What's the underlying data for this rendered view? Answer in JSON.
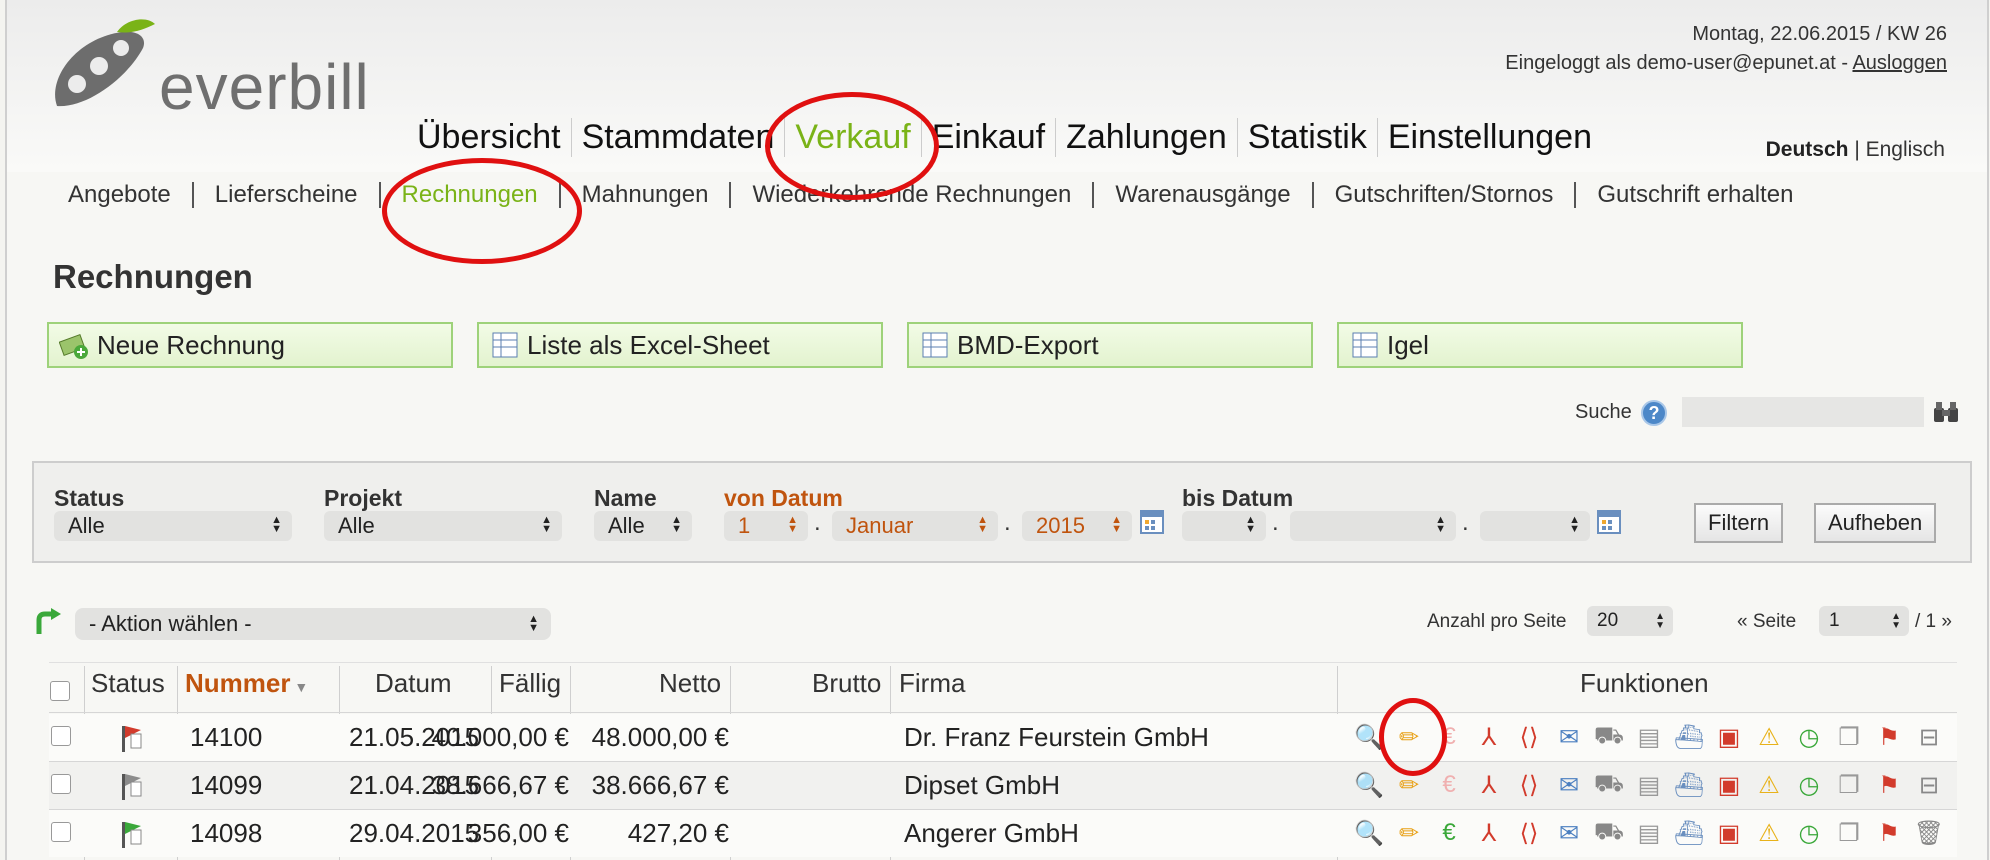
{
  "header": {
    "logo_text": "everbill",
    "date_line": "Montag, 22.06.2015 / KW 26",
    "login_prefix": "Eingeloggt als demo-user@epunet.at - ",
    "logout_label": "Ausloggen"
  },
  "mainnav": [
    "Übersicht",
    "Stammdaten",
    "Verkauf",
    "Einkauf",
    "Zahlungen",
    "Statistik",
    "Einstellungen"
  ],
  "lang": {
    "de": "Deutsch",
    "sep": " | ",
    "en": "Englisch"
  },
  "subnav": [
    "Angebote",
    "Lieferscheine",
    "Rechnungen",
    "Mahnungen",
    "Wiederkehrende Rechnungen",
    "Warenausgänge",
    "Gutschriften/Stornos",
    "Gutschrift erhalten"
  ],
  "page_title": "Rechnungen",
  "actions": [
    "Neue Rechnung",
    "Liste als Excel-Sheet",
    "BMD-Export",
    "Igel"
  ],
  "search": {
    "label": "Suche",
    "help": "?",
    "value": ""
  },
  "filter": {
    "status_label": "Status",
    "status_value": "Alle",
    "projekt_label": "Projekt",
    "projekt_value": "Alle",
    "name_label": "Name",
    "name_value": "Alle",
    "von_label": "von Datum",
    "von_day": "1",
    "von_month": "Januar",
    "von_year": "2015",
    "bis_label": "bis Datum",
    "bis_day": "",
    "bis_month": "",
    "bis_year": "",
    "dot": ".",
    "filter_button": "Filtern",
    "reset_button": "Aufheben"
  },
  "list_controls": {
    "action_select": "- Aktion wählen -",
    "per_page_label": "Anzahl pro Seite",
    "per_page_value": "20",
    "page_prefix": "« Seite",
    "page_value": "1",
    "page_suffix": "/ 1 »"
  },
  "table": {
    "headers": {
      "status": "Status",
      "nummer": "Nummer",
      "datum": "Datum",
      "faellig": "Fällig",
      "netto": "Netto",
      "brutto": "Brutto",
      "firma": "Firma",
      "funktionen": "Funktionen"
    },
    "rows": [
      {
        "nummer": "14100",
        "datum": "21.05.2015",
        "faellig": "",
        "netto": "40.000,00 €",
        "brutto": "48.000,00 €",
        "firma": "Dr. Franz Feurstein GmbH",
        "flag_color": "#d23b2c"
      },
      {
        "nummer": "14099",
        "datum": "21.04.2015",
        "faellig": "",
        "netto": "38.666,67 €",
        "brutto": "38.666,67 €",
        "firma": "Dipset GmbH",
        "flag_color": "#8c8c8c"
      },
      {
        "nummer": "14098",
        "datum": "29.04.2015",
        "faellig": "",
        "netto": "356,00 €",
        "brutto": "427,20 €",
        "firma": "Angerer GmbH",
        "flag_color": "#3aa83a"
      }
    ],
    "function_icons": [
      "magnifier-icon",
      "pencil-icon",
      "euro-icon",
      "pdf-icon",
      "xml-icon",
      "mail-icon",
      "cart-icon",
      "document-icon",
      "ship-icon",
      "reminder-icon",
      "warning-icon",
      "clock-add-icon",
      "copy-icon",
      "flag-icon",
      "trash-icon"
    ]
  },
  "colors": {
    "accent_green": "#7ab317",
    "orange": "#c0540e",
    "annotation_red": "#e01010"
  }
}
